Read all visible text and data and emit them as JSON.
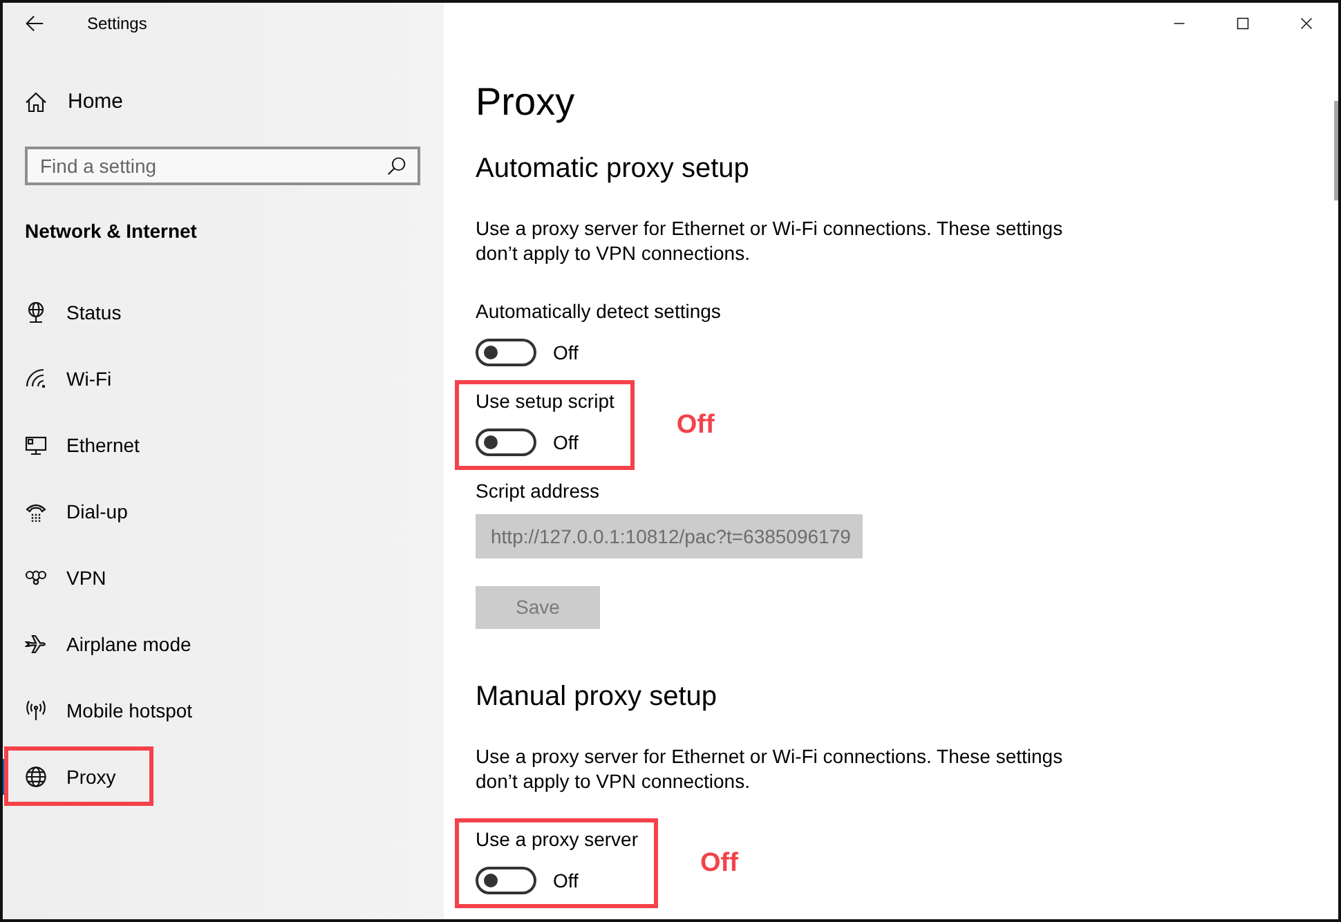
{
  "window": {
    "title": "Settings"
  },
  "sidebar": {
    "home": "Home",
    "search": {
      "placeholder": "Find a setting"
    },
    "section_title": "Network & Internet",
    "items": [
      {
        "kind": "status",
        "label": "Status",
        "selected": false,
        "highlighted": false
      },
      {
        "kind": "wifi",
        "label": "Wi-Fi",
        "selected": false,
        "highlighted": false
      },
      {
        "kind": "ethernet",
        "label": "Ethernet",
        "selected": false,
        "highlighted": false
      },
      {
        "kind": "dialup",
        "label": "Dial-up",
        "selected": false,
        "highlighted": false
      },
      {
        "kind": "vpn",
        "label": "VPN",
        "selected": false,
        "highlighted": false
      },
      {
        "kind": "airplane",
        "label": "Airplane mode",
        "selected": false,
        "highlighted": false
      },
      {
        "kind": "hotspot",
        "label": "Mobile hotspot",
        "selected": false,
        "highlighted": false
      },
      {
        "kind": "proxy",
        "label": "Proxy",
        "selected": true,
        "highlighted": true
      }
    ]
  },
  "page": {
    "title": "Proxy",
    "sections": [
      {
        "heading": "Automatic proxy setup",
        "description": "Use a proxy server for Ethernet or Wi-Fi connections. These settings don’t apply to VPN connections.",
        "settings": [
          {
            "kind": "toggle",
            "label": "Automatically detect settings",
            "on": false,
            "state_label": "Off",
            "highlighted": false
          },
          {
            "kind": "toggle",
            "label": "Use setup script",
            "on": false,
            "state_label": "Off",
            "highlighted": true,
            "callout": "Off"
          },
          {
            "kind": "field",
            "label": "Script address",
            "value": "http://127.0.0.1:10812/pac?t=6385096179",
            "disabled": true,
            "highlighted": false
          },
          {
            "kind": "button",
            "label": "Save",
            "disabled": true,
            "highlighted": false
          }
        ]
      },
      {
        "heading": "Manual proxy setup",
        "description": "Use a proxy server for Ethernet or Wi-Fi connections. These settings don’t apply to VPN connections.",
        "settings": [
          {
            "kind": "toggle",
            "label": "Use a proxy server",
            "on": false,
            "state_label": "Off",
            "highlighted": true,
            "callout": "Off"
          }
        ]
      }
    ]
  }
}
